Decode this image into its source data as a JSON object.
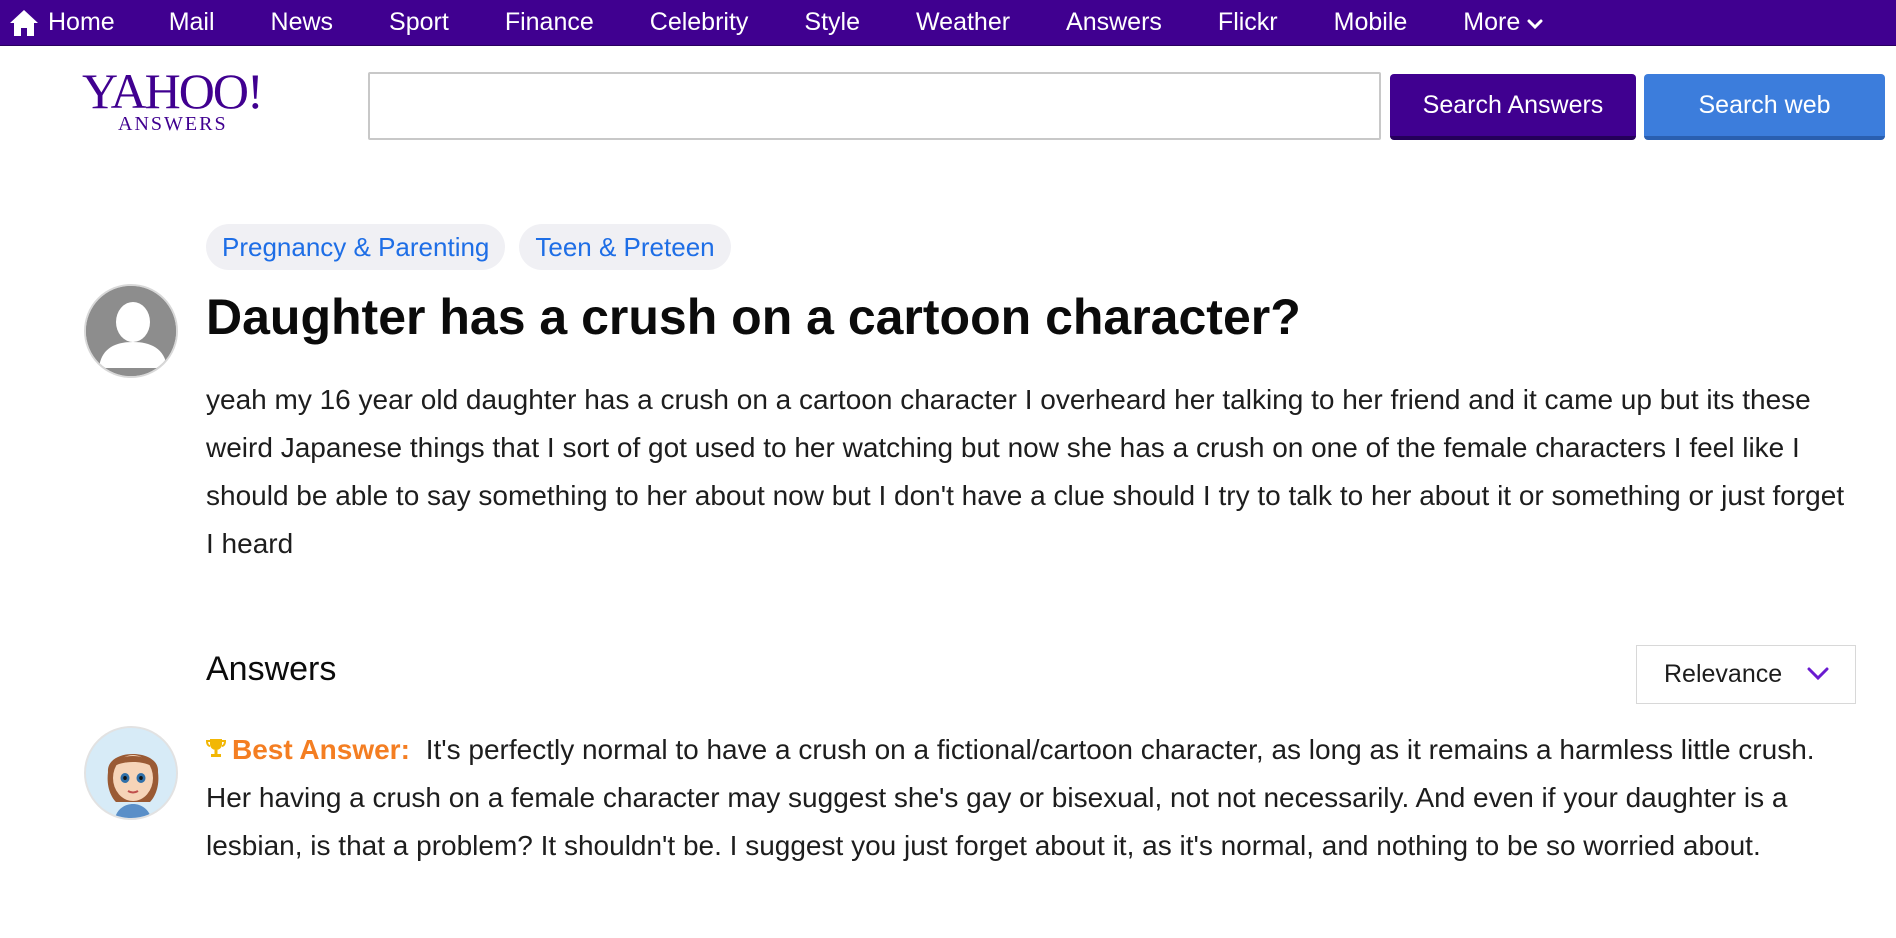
{
  "nav": {
    "items": [
      "Home",
      "Mail",
      "News",
      "Sport",
      "Finance",
      "Celebrity",
      "Style",
      "Weather",
      "Answers",
      "Flickr",
      "Mobile",
      "More"
    ],
    "background": "#400090"
  },
  "logo": {
    "main": "YAHOO!",
    "sub": "ANSWERS"
  },
  "search": {
    "value": "",
    "answers_button": "Search Answers",
    "web_button": "Search web"
  },
  "categories": [
    "Pregnancy & Parenting",
    "Teen & Preteen"
  ],
  "question": {
    "title": "Daughter has a crush on a cartoon character?",
    "body": "yeah my 16 year old daughter has a crush on a cartoon character I overheard her talking to her friend and it came up but its these weird Japanese things that I sort of got used to her watching but now she has a crush on one of the female characters I feel like I should be able to say something to her about now but I don't have a clue should I try to talk to her about it or something or just forget I heard"
  },
  "answers": {
    "heading": "Answers",
    "sort_value": "Relevance",
    "best_label": "Best Answer:",
    "best_text": "It's perfectly normal to have a crush on a fictional/cartoon character, as long as it remains a harmless little crush. Her having a crush on a female character may suggest she's gay or bisexual, not not necessarily. And even if your daughter is a lesbian, is that a problem? It shouldn't be. I suggest you just forget about it, as it's normal, and nothing to be so worried about."
  },
  "colors": {
    "brand_purple": "#400090",
    "web_blue": "#3c7ddc",
    "link_blue": "#1e6ee6",
    "best_orange": "#f47e22"
  },
  "icons": [
    "home-icon",
    "chevron-down-icon",
    "trophy-icon",
    "default-avatar-icon"
  ]
}
